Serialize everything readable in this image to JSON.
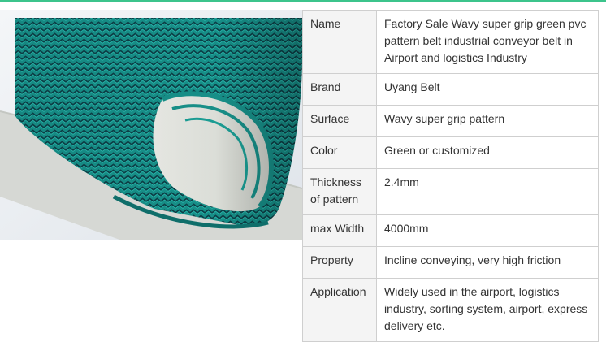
{
  "specs": [
    {
      "label": "Name",
      "value": "Factory Sale Wavy super grip green pvc pattern belt industrial conveyor belt in Airport and logistics Industry"
    },
    {
      "label": "Brand",
      "value": "Uyang Belt"
    },
    {
      "label": "Surface",
      "value": "Wavy super grip pattern"
    },
    {
      "label": "Color",
      "value": "Green or customized"
    },
    {
      "label": "Thickness of pattern",
      "value": "2.4mm"
    },
    {
      "label": "max Width",
      "value": "4000mm"
    },
    {
      "label": "Property",
      "value": "Incline conveying, very high friction"
    },
    {
      "label": "Application",
      "value": "Widely used in the airport, logistics industry, sorting system, airport, express delivery etc."
    }
  ],
  "image": {
    "subject": "rolled green wavy pattern conveyor belt",
    "icon": "product-photo"
  },
  "colors": {
    "accent": "#3cc48c",
    "belt_green": "#1f9e96",
    "border": "#cfcfcf",
    "label_bg": "#f4f4f4"
  }
}
